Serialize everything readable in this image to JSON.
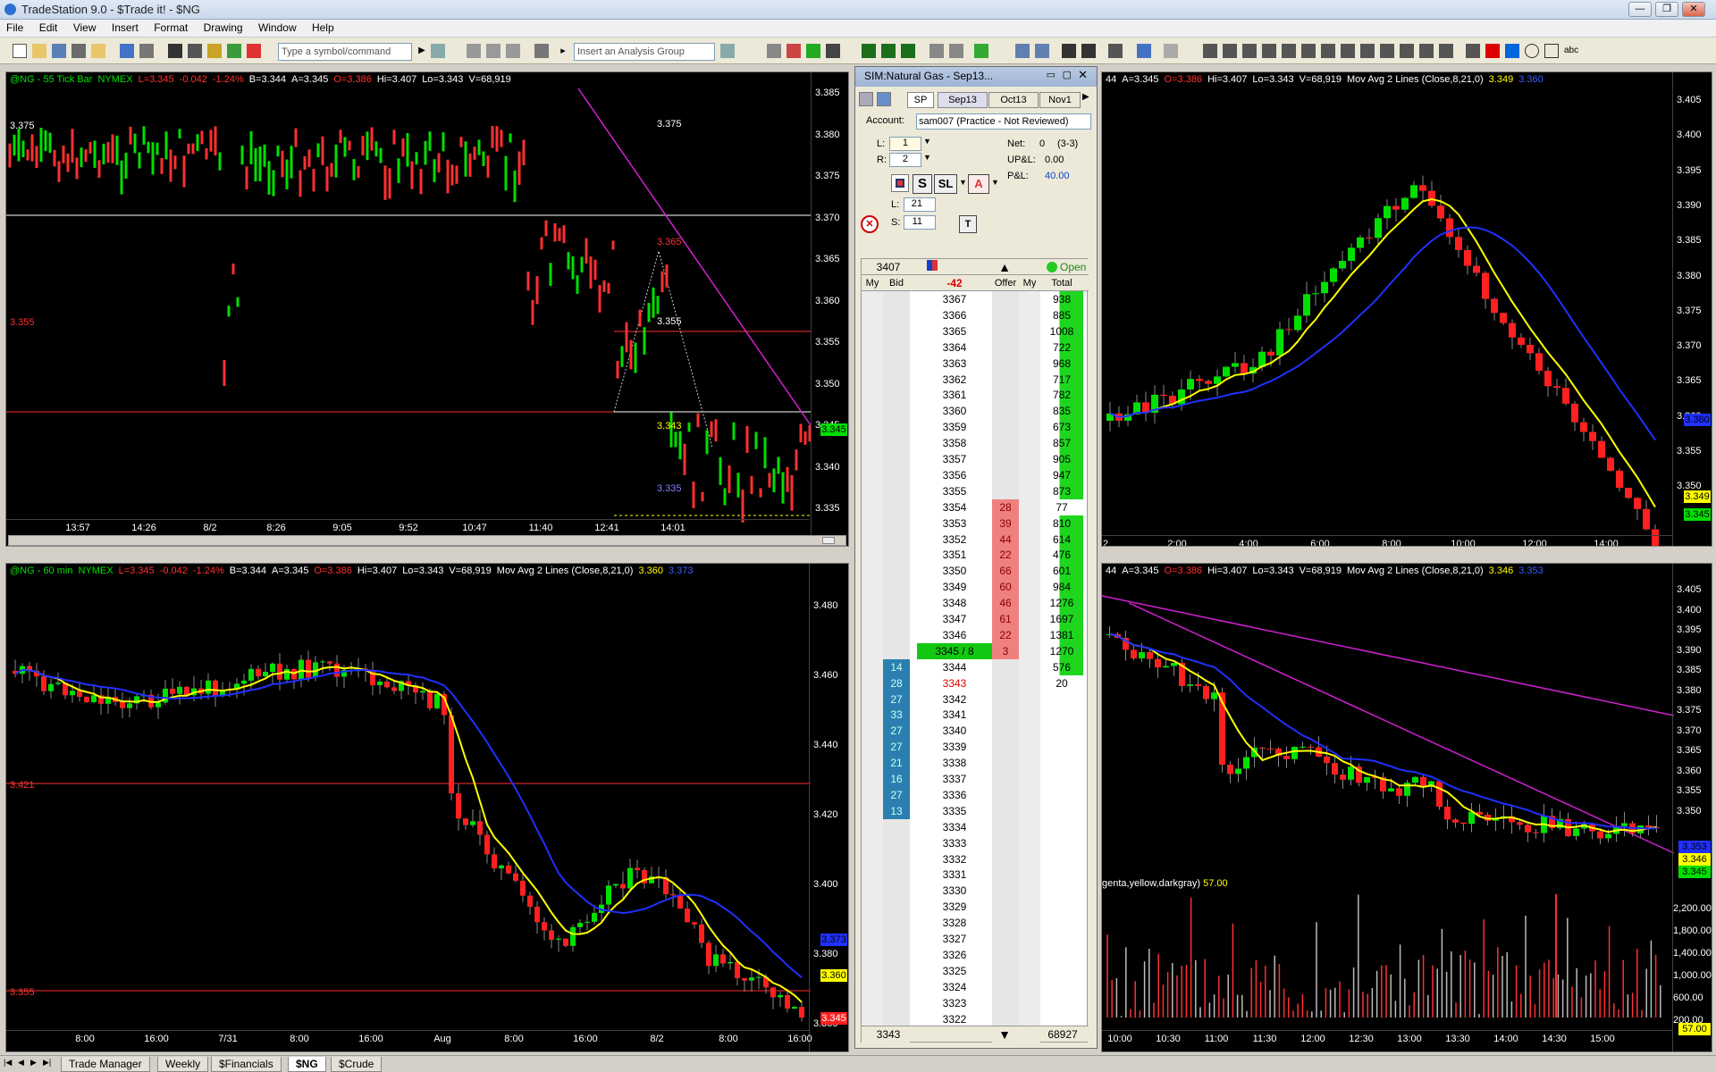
{
  "app": {
    "title": "TradeStation 9.0 - $Trade it! - $NG"
  },
  "menu": [
    "File",
    "Edit",
    "View",
    "Insert",
    "Format",
    "Drawing",
    "Window",
    "Help"
  ],
  "toolbar": {
    "symbol_placeholder": "Type a symbol/command",
    "analysis_placeholder": "Insert an Analysis Group"
  },
  "chart_tl": {
    "header": [
      {
        "t": "@NG - 55 Tick Bar",
        "c": "g"
      },
      {
        "t": "NYMEX",
        "c": "g"
      },
      {
        "t": "L=3.345",
        "c": "r"
      },
      {
        "t": "-0.042",
        "c": "r"
      },
      {
        "t": "-1.24%",
        "c": "r"
      },
      {
        "t": "B=3.344",
        "c": "w"
      },
      {
        "t": "A=3.345",
        "c": "w"
      },
      {
        "t": "O=3.386",
        "c": "r"
      },
      {
        "t": "Hi=3.407",
        "c": "w"
      },
      {
        "t": "Lo=3.343",
        "c": "w"
      },
      {
        "t": "V=68,919",
        "c": "w"
      }
    ],
    "prices": [
      "3.385",
      "3.380",
      "3.375",
      "3.370",
      "3.365",
      "3.360",
      "3.355",
      "3.350",
      "3.345",
      "3.340",
      "3.335"
    ],
    "times": [
      "13:57",
      "14:26",
      "8/2",
      "8:26",
      "9:05",
      "9:52",
      "10:47",
      "11:40",
      "12:41",
      "14:01"
    ],
    "levels": {
      "l3375": "3.375",
      "l3355": "3.355",
      "l3365": "3.365",
      "l3355b": "3.355",
      "l3343": "3.343",
      "l3335": "3.335",
      "l3375b": "3.375"
    },
    "last": "3.345"
  },
  "chart_bl": {
    "header": [
      {
        "t": "@NG - 60 min",
        "c": "g"
      },
      {
        "t": "NYMEX",
        "c": "g"
      },
      {
        "t": "L=3.345",
        "c": "r"
      },
      {
        "t": "-0.042",
        "c": "r"
      },
      {
        "t": "-1.24%",
        "c": "r"
      },
      {
        "t": "B=3.344",
        "c": "w"
      },
      {
        "t": "A=3.345",
        "c": "w"
      },
      {
        "t": "O=3.386",
        "c": "r"
      },
      {
        "t": "Hi=3.407",
        "c": "w"
      },
      {
        "t": "Lo=3.343",
        "c": "w"
      },
      {
        "t": "V=68,919",
        "c": "w"
      },
      {
        "t": "Mov Avg 2 Lines (Close,8,21,0)",
        "c": "w"
      },
      {
        "t": "3.360",
        "c": "y"
      },
      {
        "t": "3.373",
        "c": "b"
      }
    ],
    "prices": [
      "3.480",
      "3.460",
      "3.440",
      "3.420",
      "3.400",
      "3.380",
      "3.360"
    ],
    "times": [
      "8:00",
      "16:00",
      "7/31",
      "8:00",
      "16:00",
      "Aug",
      "8:00",
      "16:00",
      "8/2",
      "8:00",
      "16:00"
    ],
    "levels": {
      "l3421": "3.421",
      "l3355": "3.355"
    },
    "tags": {
      "blue": "3.373",
      "yellow": "3.360",
      "red": "3.345"
    }
  },
  "chart_tr": {
    "header": [
      {
        "t": "44",
        "c": "w"
      },
      {
        "t": "A=3.345",
        "c": "w"
      },
      {
        "t": "O=3.386",
        "c": "r"
      },
      {
        "t": "Hi=3.407",
        "c": "w"
      },
      {
        "t": "Lo=3.343",
        "c": "w"
      },
      {
        "t": "V=68,919",
        "c": "w"
      },
      {
        "t": "Mov Avg 2 Lines (Close,8,21,0)",
        "c": "w"
      },
      {
        "t": "3.349",
        "c": "y"
      },
      {
        "t": "3.360",
        "c": "b"
      }
    ],
    "prices": [
      "3.405",
      "3.400",
      "3.395",
      "3.390",
      "3.385",
      "3.380",
      "3.375",
      "3.370",
      "3.365",
      "3.360",
      "3.355",
      "3.350"
    ],
    "times": [
      "2",
      "2:00",
      "4:00",
      "6:00",
      "8:00",
      "10:00",
      "12:00",
      "14:00"
    ],
    "tags": {
      "blue": "3.360",
      "yellow": "3.349",
      "green": "3.345"
    }
  },
  "chart_br": {
    "header": [
      {
        "t": "44",
        "c": "w"
      },
      {
        "t": "A=3.345",
        "c": "w"
      },
      {
        "t": "O=3.386",
        "c": "r"
      },
      {
        "t": "Hi=3.407",
        "c": "w"
      },
      {
        "t": "Lo=3.343",
        "c": "w"
      },
      {
        "t": "V=68,919",
        "c": "w"
      },
      {
        "t": "Mov Avg 2 Lines (Close,8,21,0)",
        "c": "w"
      },
      {
        "t": "3.346",
        "c": "y"
      },
      {
        "t": "3.353",
        "c": "b"
      }
    ],
    "prices": [
      "3.405",
      "3.400",
      "3.395",
      "3.390",
      "3.385",
      "3.380",
      "3.375",
      "3.370",
      "3.365",
      "3.360",
      "3.355",
      "3.350"
    ],
    "vol_prices": [
      "2,200.00",
      "1,800.00",
      "1,400.00",
      "1,000.00",
      "600.00",
      "200.00"
    ],
    "times": [
      "10:00",
      "10:30",
      "11:00",
      "11:30",
      "12:00",
      "12:30",
      "13:00",
      "13:30",
      "14:00",
      "14:30",
      "15:00"
    ],
    "volume_label": "genta,yellow,darkgray)",
    "volume_value": "57.00",
    "tags": {
      "blue": "3.353",
      "yellow": "3.346",
      "green": "3.345",
      "vol": "57.00"
    }
  },
  "matrix": {
    "title": "SIM:Natural Gas - Sep13...",
    "exch": "SP",
    "months": [
      "Sep13",
      "Oct13",
      "Nov1"
    ],
    "account_label": "Account:",
    "account_value": "sam007 (Practice - Not Reviewed)",
    "L_label": "L:",
    "L_value": "1",
    "R_label": "R:",
    "R_value": "2",
    "net_label": "Net:",
    "net_value": "0",
    "net_extra": "(3-3)",
    "upl_label": "UP&L:",
    "upl_value": "0.00",
    "pl_label": "P&L:",
    "pl_value": "40.00",
    "btn_s": "S",
    "btn_sl": "SL",
    "btn_a": "A",
    "L2_label": "L:",
    "L2_value": "21",
    "S_label": "S:",
    "S_value": "11",
    "btn_t": "T",
    "top_price": "3407",
    "open_label": "Open",
    "cols": [
      "My B",
      "Bid",
      "-42",
      "Offer",
      "My C",
      "Total"
    ],
    "rows": [
      {
        "p": "3367",
        "o": "",
        "b": "",
        "t": "938"
      },
      {
        "p": "3366",
        "o": "",
        "b": "",
        "t": "885"
      },
      {
        "p": "3365",
        "o": "",
        "b": "",
        "t": "1008"
      },
      {
        "p": "3364",
        "o": "",
        "b": "",
        "t": "722"
      },
      {
        "p": "3363",
        "o": "",
        "b": "",
        "t": "968"
      },
      {
        "p": "3362",
        "o": "",
        "b": "",
        "t": "717"
      },
      {
        "p": "3361",
        "o": "",
        "b": "",
        "t": "782"
      },
      {
        "p": "3360",
        "o": "",
        "b": "",
        "t": "835"
      },
      {
        "p": "3359",
        "o": "",
        "b": "",
        "t": "673"
      },
      {
        "p": "3358",
        "o": "",
        "b": "",
        "t": "857"
      },
      {
        "p": "3357",
        "o": "",
        "b": "",
        "t": "905"
      },
      {
        "p": "3356",
        "o": "",
        "b": "",
        "t": "947"
      },
      {
        "p": "3355",
        "o": "",
        "b": "",
        "t": "873"
      },
      {
        "p": "3354",
        "o": "28",
        "b": "",
        "t": "77"
      },
      {
        "p": "3353",
        "o": "39",
        "b": "",
        "t": "810"
      },
      {
        "p": "3352",
        "o": "44",
        "b": "",
        "t": "614"
      },
      {
        "p": "3351",
        "o": "22",
        "b": "",
        "t": "476"
      },
      {
        "p": "3350",
        "o": "66",
        "b": "",
        "t": "601"
      },
      {
        "p": "3349",
        "o": "60",
        "b": "",
        "t": "984"
      },
      {
        "p": "3348",
        "o": "46",
        "b": "",
        "t": "1276"
      },
      {
        "p": "3347",
        "o": "61",
        "b": "",
        "t": "1697"
      },
      {
        "p": "3346",
        "o": "22",
        "b": "",
        "t": "1381"
      },
      {
        "p": "3345 / 8",
        "o": "3",
        "b": "",
        "t": "1270"
      },
      {
        "p": "3344",
        "o": "",
        "b": "14",
        "t": "576"
      },
      {
        "p": "3343",
        "o": "",
        "b": "28",
        "t": "20"
      },
      {
        "p": "3342",
        "o": "",
        "b": "27",
        "t": ""
      },
      {
        "p": "3341",
        "o": "",
        "b": "33",
        "t": ""
      },
      {
        "p": "3340",
        "o": "",
        "b": "27",
        "t": ""
      },
      {
        "p": "3339",
        "o": "",
        "b": "27",
        "t": ""
      },
      {
        "p": "3338",
        "o": "",
        "b": "21",
        "t": ""
      },
      {
        "p": "3337",
        "o": "",
        "b": "16",
        "t": ""
      },
      {
        "p": "3336",
        "o": "",
        "b": "27",
        "t": ""
      },
      {
        "p": "3335",
        "o": "",
        "b": "13",
        "t": ""
      },
      {
        "p": "3334",
        "o": "",
        "b": "",
        "t": ""
      },
      {
        "p": "3333",
        "o": "",
        "b": "",
        "t": ""
      },
      {
        "p": "3332",
        "o": "",
        "b": "",
        "t": ""
      },
      {
        "p": "3331",
        "o": "",
        "b": "",
        "t": ""
      },
      {
        "p": "3330",
        "o": "",
        "b": "",
        "t": ""
      },
      {
        "p": "3329",
        "o": "",
        "b": "",
        "t": ""
      },
      {
        "p": "3328",
        "o": "",
        "b": "",
        "t": ""
      },
      {
        "p": "3327",
        "o": "",
        "b": "",
        "t": ""
      },
      {
        "p": "3326",
        "o": "",
        "b": "",
        "t": ""
      },
      {
        "p": "3325",
        "o": "",
        "b": "",
        "t": ""
      },
      {
        "p": "3324",
        "o": "",
        "b": "",
        "t": ""
      },
      {
        "p": "3323",
        "o": "",
        "b": "",
        "t": ""
      },
      {
        "p": "3322",
        "o": "",
        "b": "",
        "t": ""
      },
      {
        "p": "3321",
        "o": "",
        "b": "",
        "t": ""
      }
    ],
    "footer_left": "3343",
    "footer_right": "68927"
  },
  "tabs": [
    "Trade Manager",
    "Weekly",
    "$Financials",
    "$NG",
    "$Crude"
  ],
  "colors": {
    "green": "#00e000",
    "red": "#ff3030",
    "yellow": "#ffff00",
    "blue": "#2030ff",
    "magenta": "#d020d0",
    "offer": "#f08080",
    "bid": "#2a7fb0",
    "total": "#1ed61e"
  }
}
